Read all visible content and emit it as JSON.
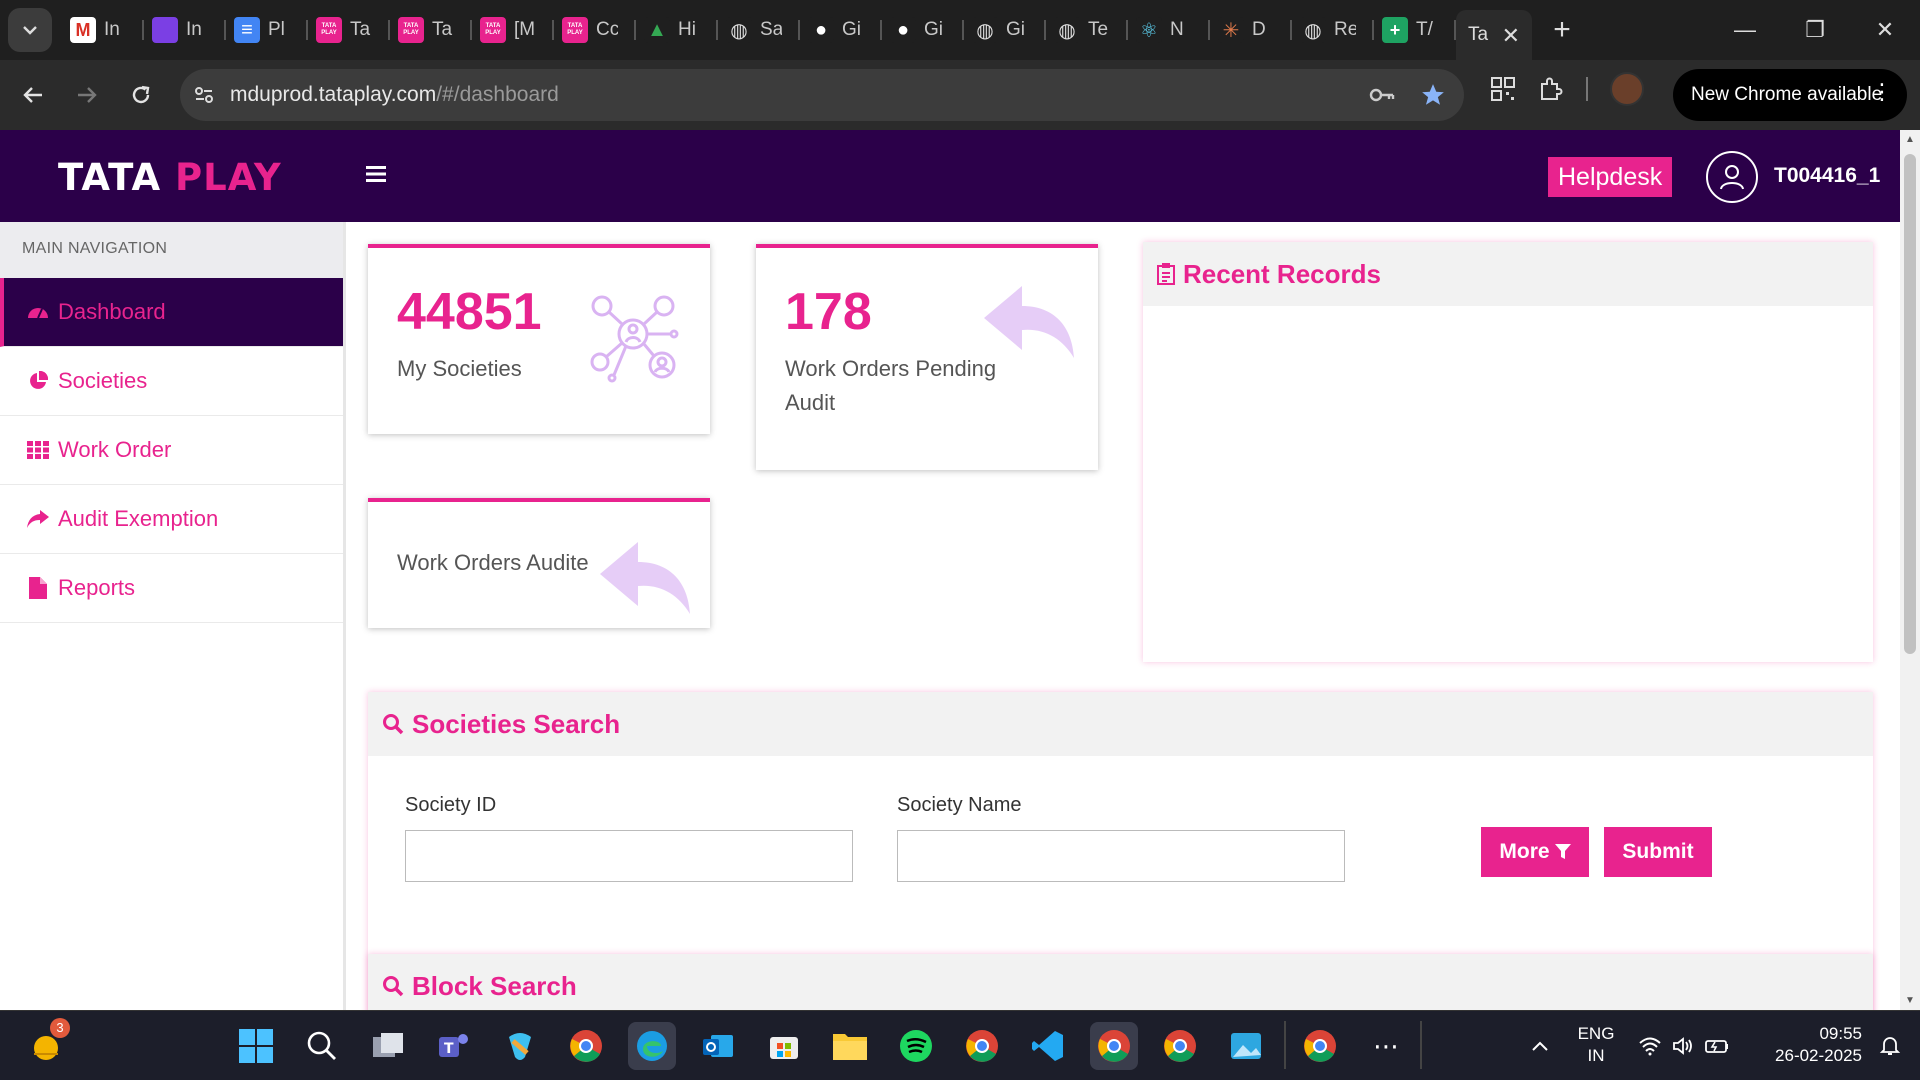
{
  "browser": {
    "tabs": [
      {
        "short": "In",
        "fav_color": "#ffffff",
        "fav_letter": "M",
        "fav_text_color": "#d93025"
      },
      {
        "short": "In",
        "fav_color": "#7b3fe4",
        "fav_letter": "",
        "fav_text_color": "#ffffff"
      },
      {
        "short": "Pl",
        "fav_color": "#4285f4",
        "fav_letter": "≡",
        "fav_text_color": "#ffffff"
      },
      {
        "short": "Ta",
        "fav_color": "#e8238e",
        "fav_letter": "TATA PLAY",
        "fav_text_color": "#ffffff"
      },
      {
        "short": "Ta",
        "fav_color": "#e8238e",
        "fav_letter": "TATA PLAY",
        "fav_text_color": "#ffffff"
      },
      {
        "short": "[M",
        "fav_color": "#e8238e",
        "fav_letter": "TATA PLAY",
        "fav_text_color": "#ffffff"
      },
      {
        "short": "Cc",
        "fav_color": "#e8238e",
        "fav_letter": "TATA PLAY",
        "fav_text_color": "#ffffff"
      },
      {
        "short": "Hi",
        "fav_color": "#1f1f1f",
        "fav_letter": "▲",
        "fav_text_color": "#34a853"
      },
      {
        "short": "Sa",
        "fav_color": "#1f1f1f",
        "fav_letter": "◍",
        "fav_text_color": "#dddddd"
      },
      {
        "short": "Gi",
        "fav_color": "#1f1f1f",
        "fav_letter": "●",
        "fav_text_color": "#ffffff"
      },
      {
        "short": "Gi",
        "fav_color": "#1f1f1f",
        "fav_letter": "●",
        "fav_text_color": "#ffffff"
      },
      {
        "short": "Gi",
        "fav_color": "#1f1f1f",
        "fav_letter": "◍",
        "fav_text_color": "#dddddd"
      },
      {
        "short": "Te",
        "fav_color": "#1f1f1f",
        "fav_letter": "◍",
        "fav_text_color": "#dddddd"
      },
      {
        "short": "N",
        "fav_color": "#1f1f1f",
        "fav_letter": "⚛",
        "fav_text_color": "#61dafb"
      },
      {
        "short": "D",
        "fav_color": "#1f1f1f",
        "fav_letter": "✳",
        "fav_text_color": "#e07a4b"
      },
      {
        "short": "Re",
        "fav_color": "#1f1f1f",
        "fav_letter": "◍",
        "fav_text_color": "#dddddd"
      },
      {
        "short": "T/",
        "fav_color": "#1ea362",
        "fav_letter": "+",
        "fav_text_color": "#ffffff"
      }
    ],
    "active_tab": {
      "short": "Ta"
    },
    "url_host": "mduprod.tataplay.com",
    "url_path": "/#/dashboard",
    "new_chrome": "New Chrome available"
  },
  "header": {
    "logo_part1": "TATA",
    "logo_part2": "PLAY",
    "helpdesk": "Helpdesk",
    "username": "T004416_1"
  },
  "sidebar": {
    "heading": "MAIN NAVIGATION",
    "items": [
      {
        "label": "Dashboard",
        "icon": "dashboard-gauge-icon"
      },
      {
        "label": "Societies",
        "icon": "pie-chart-icon"
      },
      {
        "label": "Work Order",
        "icon": "grid-icon"
      },
      {
        "label": "Audit Exemption",
        "icon": "share-arrow-icon"
      },
      {
        "label": "Reports",
        "icon": "file-icon"
      }
    ]
  },
  "cards": {
    "societies": {
      "value": "44851",
      "label": "My Societies"
    },
    "pending": {
      "value": "178",
      "label_line1": "Work Orders Pending",
      "label_line2": "Audit"
    },
    "audited": {
      "label": "Work Orders Audite"
    }
  },
  "recent": {
    "title": "Recent Records"
  },
  "society_search": {
    "title": "Societies Search",
    "id_label": "Society ID",
    "id_value": "",
    "name_label": "Society Name",
    "name_value": "",
    "more": "More",
    "submit": "Submit"
  },
  "block_search": {
    "title": "Block Search"
  },
  "taskbar": {
    "notification_count": "3",
    "lang1": "ENG",
    "lang2": "IN",
    "time": "09:55",
    "date": "26-02-2025"
  },
  "colors": {
    "brand": "#e8238e",
    "header_bg": "#2b0049"
  }
}
